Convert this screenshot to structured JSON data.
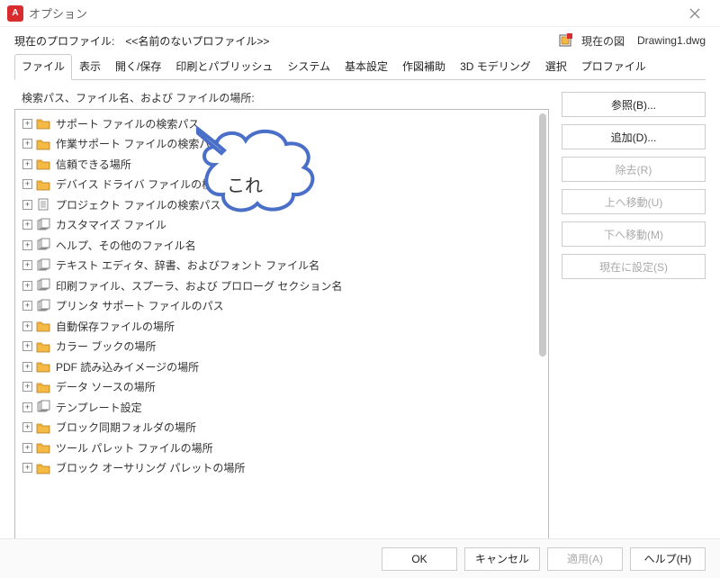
{
  "window": {
    "title": "オプション",
    "app_letter": "A"
  },
  "profile": {
    "label": "現在のプロファイル:",
    "name": "<<名前のないプロファイル>>",
    "drawing_label": "現在の図",
    "drawing_file": "Drawing1.dwg"
  },
  "tabs": {
    "items": [
      {
        "label": "ファイル",
        "active": true
      },
      {
        "label": "表示"
      },
      {
        "label": "開く/保存"
      },
      {
        "label": "印刷とパブリッシュ"
      },
      {
        "label": "システム"
      },
      {
        "label": "基本設定"
      },
      {
        "label": "作図補助"
      },
      {
        "label": "3D モデリング"
      },
      {
        "label": "選択"
      },
      {
        "label": "プロファイル"
      }
    ]
  },
  "section": {
    "label": "検索パス、ファイル名、および ファイルの場所:"
  },
  "tree": {
    "items": [
      {
        "icon": "folder",
        "label": "サポート ファイルの検索パス"
      },
      {
        "icon": "folder",
        "label": "作業サポート ファイルの検索パス"
      },
      {
        "icon": "folder",
        "label": "信頼できる場所"
      },
      {
        "icon": "folder",
        "label": "デバイス ドライバ ファイルの検索パス"
      },
      {
        "icon": "doc",
        "label": "プロジェクト ファイルの検索パス"
      },
      {
        "icon": "stack",
        "label": "カスタマイズ ファイル"
      },
      {
        "icon": "stack",
        "label": "ヘルプ、その他のファイル名"
      },
      {
        "icon": "stack",
        "label": "テキスト エディタ、辞書、およびフォント ファイル名"
      },
      {
        "icon": "stack",
        "label": "印刷ファイル、スプーラ、および プロローグ セクション名"
      },
      {
        "icon": "stack",
        "label": "プリンタ サポート ファイルのパス"
      },
      {
        "icon": "folder",
        "label": "自動保存ファイルの場所"
      },
      {
        "icon": "folder",
        "label": "カラー ブックの場所"
      },
      {
        "icon": "folder",
        "label": "PDF 読み込みイメージの場所"
      },
      {
        "icon": "folder",
        "label": "データ ソースの場所"
      },
      {
        "icon": "stack",
        "label": "テンプレート設定"
      },
      {
        "icon": "folder",
        "label": "ブロック同期フォルダの場所"
      },
      {
        "icon": "folder",
        "label": "ツール パレット ファイルの場所"
      },
      {
        "icon": "folder",
        "label": "ブロック オーサリング パレットの場所"
      }
    ]
  },
  "side_buttons": {
    "browse": "参照(B)...",
    "add": "追加(D)...",
    "remove": "除去(R)",
    "move_up": "上へ移動(U)",
    "move_down": "下へ移動(M)",
    "set_current": "現在に設定(S)"
  },
  "bottom_buttons": {
    "ok": "OK",
    "cancel": "キャンセル",
    "apply": "適用(A)",
    "help": "ヘルプ(H)"
  },
  "callout": {
    "text": "これ"
  }
}
